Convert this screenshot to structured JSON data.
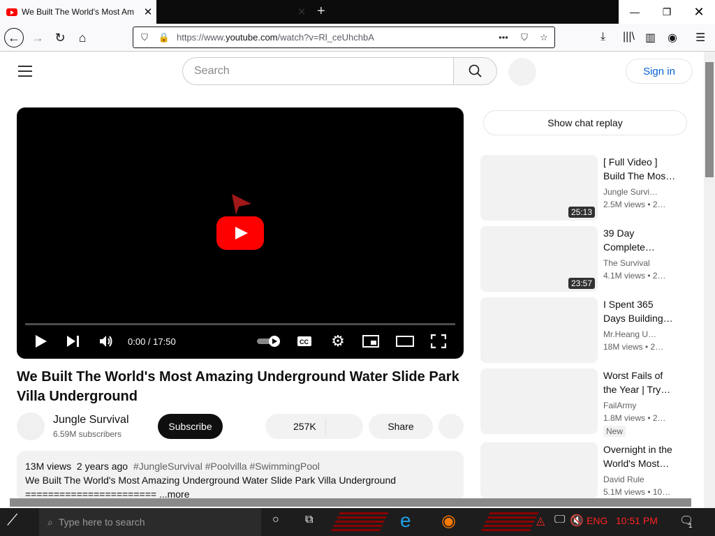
{
  "browser": {
    "tabs": [
      {
        "title": "We Built The World's Most Am",
        "active": true
      },
      {
        "title": "",
        "active": false
      }
    ],
    "url_prefix": "https://www.",
    "url_domain": "youtube.com",
    "url_path": "/watch?v=Rl_ceUhchbA"
  },
  "header": {
    "search_placeholder": "Search",
    "signin_label": "Sign in"
  },
  "player": {
    "time": "0:00 / 17:50"
  },
  "video": {
    "title": "We Built The World's Most Amazing Underground Water Slide Park Villa Underground",
    "channel": "Jungle Survival",
    "subscribers": "6.59M subscribers",
    "subscribe_label": "Subscribe",
    "likes": "257K",
    "share_label": "Share",
    "views": "13M views",
    "age": "2 years ago",
    "tags": "#JungleSurvival #Poolvilla #SwimmingPool",
    "description_line1": "We Built The World's Most Amazing Underground Water Slide Park Villa Underground",
    "description_line2": "=======================",
    "more_label": "...more"
  },
  "sidebar": {
    "chat_replay_label": "Show chat replay",
    "recommendations": [
      {
        "title": "[ Full Video ] Build The Mos…",
        "channel": "Jungle Survi…",
        "meta": "2.5M views  • 2…",
        "duration": "25:13",
        "badge": ""
      },
      {
        "title": "39 Day Complete…",
        "channel": "The Survival",
        "meta": "4.1M views  • 2…",
        "duration": "23:57",
        "badge": ""
      },
      {
        "title": "I Spent 365 Days Building…",
        "channel": "Mr.Heang U…",
        "meta": "18M views  • 2…",
        "duration": "",
        "badge": ""
      },
      {
        "title": "Worst Fails of the Year | Try…",
        "channel": "FailArmy",
        "meta": "1.8M views  • 2…",
        "duration": "",
        "badge": "New"
      },
      {
        "title": "Overnight in the World's Most…",
        "channel": "David Rule",
        "meta": "5.1M views  • 10…",
        "duration": "",
        "badge": ""
      }
    ]
  },
  "taskbar": {
    "search_placeholder": "Type here to search",
    "language": "ENG",
    "time": "10:51 PM",
    "notification_count": "1"
  },
  "colors": {
    "youtube_red": "#ff0000",
    "link_blue": "#065fd4",
    "taskbar_accent": "#ff2222"
  }
}
